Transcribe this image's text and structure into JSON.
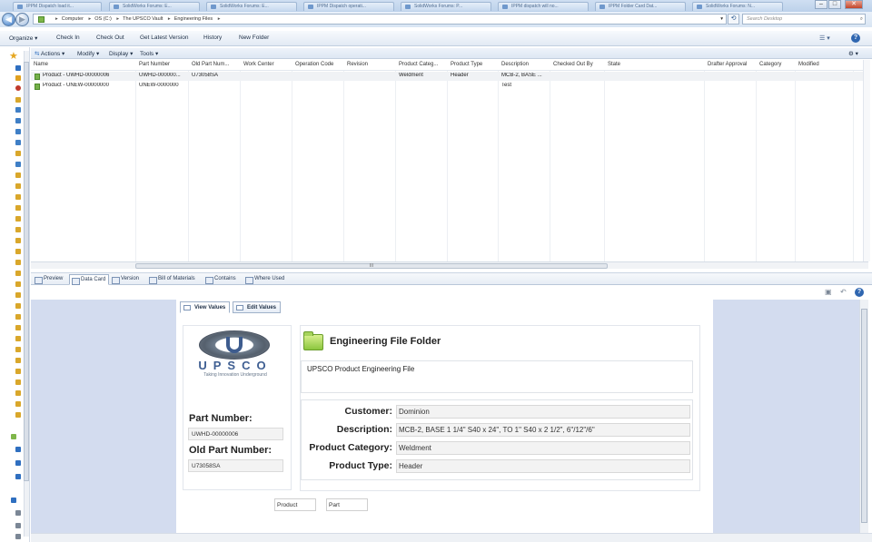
{
  "browser_tabs": [
    "IPPM Dispatch load it...",
    "SolidWorks Forums: E...",
    "SolidWorks Forums: E...",
    "IPPM Dispatch operati...",
    "SolidWorks Forums: P...",
    "IPPM dispatch will no...",
    "IPPM Folder Card Dat...",
    "SolidWorks Forums: N..."
  ],
  "address": {
    "crumbs": [
      "Computer",
      "OS (C:)",
      "The UPSCO Vault",
      "Engineering Files"
    ],
    "search_placeholder": "Search Desktop"
  },
  "command_bar": {
    "organize": "Organize",
    "check_in": "Check In",
    "check_out": "Check Out",
    "get_latest": "Get Latest Version",
    "history": "History",
    "new_folder": "New Folder"
  },
  "actions_bar": {
    "actions": "Actions",
    "modify": "Modify",
    "display": "Display",
    "tools": "Tools"
  },
  "columns": [
    "Name",
    "Part Number",
    "Old Part Num...",
    "Work Center",
    "Operation Code",
    "Revision",
    "Product Categ...",
    "Product Type",
    "Description",
    "Checked Out By",
    "State",
    "Drafter Approval",
    "Category",
    "Modified"
  ],
  "rows": [
    {
      "name": "Product - UWHD-00000006",
      "part_number": "UWHD-000000...",
      "old_part": "U73058SA",
      "category": "Weldment",
      "type": "Header",
      "description": "MCB-2, BASE ..."
    },
    {
      "name": "Product - UNEW-00000000",
      "part_number": "UNEW-0000000",
      "old_part": "",
      "category": "",
      "type": "",
      "description": "Test"
    }
  ],
  "scroll_marker": "III",
  "bottom_tabs": [
    "Preview",
    "Data Card",
    "Version",
    "Bill of Materials",
    "Contains",
    "Where Used"
  ],
  "card": {
    "view_tab": "View Values",
    "edit_tab": "Edit Values",
    "logo_text": "UPSCO",
    "logo_tagline": "Taking Innovation Underground",
    "folder_title": "Engineering File Folder",
    "description": "UPSCO Product Engineering File",
    "part_number_label": "Part Number:",
    "part_number_value": "UWHD-00000006",
    "old_part_number_label": "Old Part Number:",
    "old_part_number_value": "U73058SA",
    "customer_label": "Customer:",
    "customer_value": "Dominion",
    "description_label": "Description:",
    "description_value": "MCB-2, BASE 1 1/4\" S40 x 24\", TO 1\" S40 x 2 1/2\", 6\"/12\"/6\"",
    "product_category_label": "Product Category:",
    "product_category_value": "Weldment",
    "product_type_label": "Product Type:",
    "product_type_value": "Header",
    "footer_product": "Product",
    "footer_part": "Part"
  }
}
